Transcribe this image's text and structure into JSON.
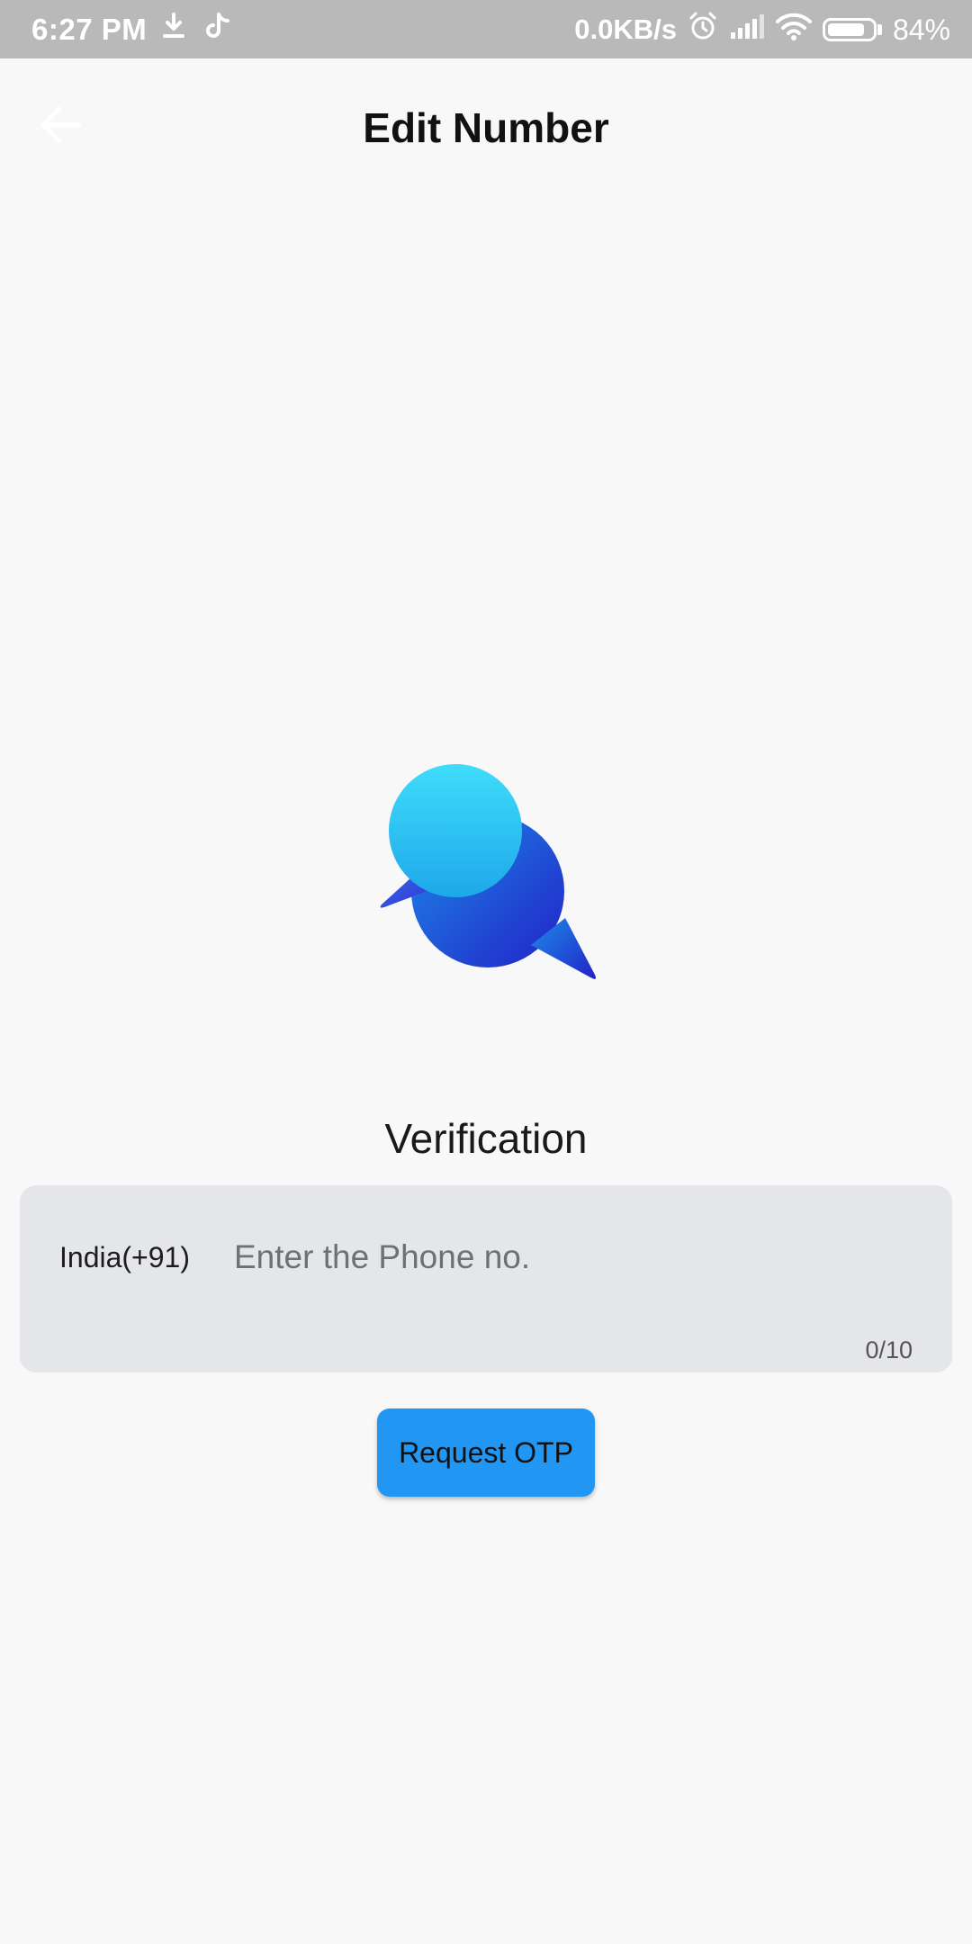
{
  "status_bar": {
    "time": "6:27 PM",
    "left_icons": [
      "download-icon",
      "tiktok-icon"
    ],
    "net_speed": "0.0KB/s",
    "right_icons": [
      "alarm-icon",
      "signal-icon",
      "wifi-icon",
      "battery-icon"
    ],
    "battery_percent": "84%",
    "battery_level": 0.84
  },
  "app_bar": {
    "title": "Edit Number",
    "back_icon": "arrow-left-icon"
  },
  "logo": {
    "icon": "chat-bubbles-icon"
  },
  "verification": {
    "title": "Verification",
    "country_code": "India(+91)",
    "phone_value": "",
    "phone_placeholder": "Enter the Phone no.",
    "char_counter": "0/10",
    "button_label": "Request OTP"
  },
  "colors": {
    "status_bar_bg": "#b9b9b9",
    "page_bg": "#f8f8f8",
    "field_bg": "#e5e6ea",
    "button_bg": "#2196f3",
    "bubble_light": "#36c8f6",
    "bubble_dark": "#1a3fd4"
  }
}
